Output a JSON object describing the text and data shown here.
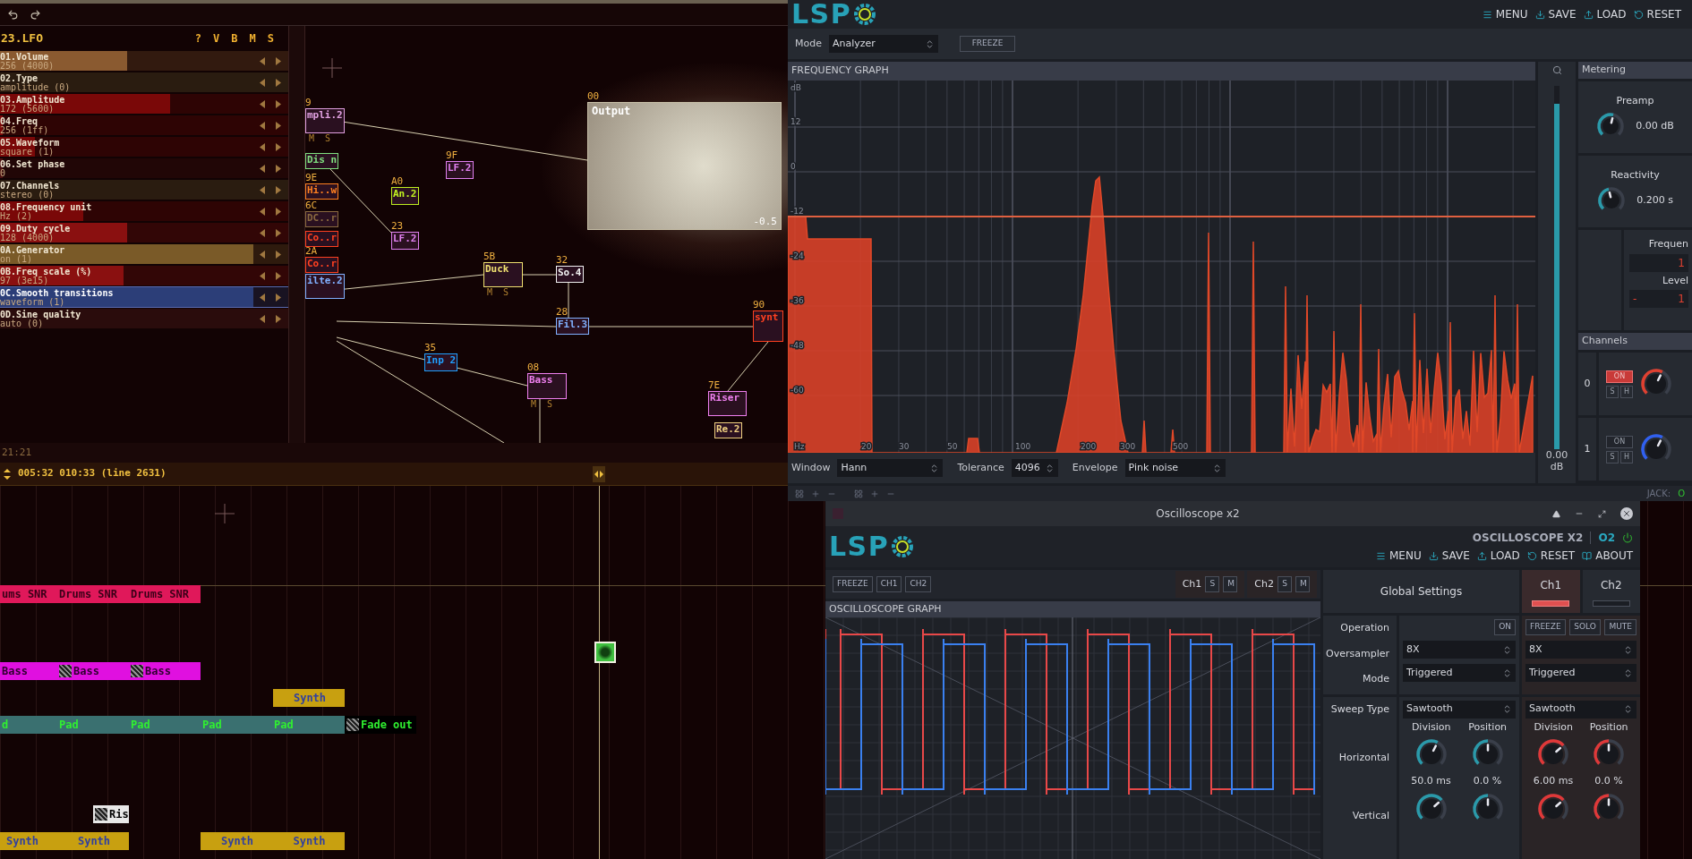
{
  "tracker": {
    "instrument": {
      "title": "23.LFO",
      "header_buttons": [
        "?",
        "V",
        "B",
        "M",
        "S"
      ]
    },
    "params": [
      {
        "name": "01.Volume",
        "value": "256 (4000)",
        "level": 0.44,
        "color": "#8a5a30",
        "selected": false
      },
      {
        "name": "02.Type",
        "value": "amplitude (0)",
        "level": 0,
        "color": "#2a1c10",
        "selected": false
      },
      {
        "name": "03.Amplitude",
        "value": "172 (5600)",
        "level": 0.59,
        "color": "#7a0808",
        "selected": false
      },
      {
        "name": "04.Freq",
        "value": "256 (1ff)",
        "level": 0.01,
        "color": "#7a0808",
        "selected": false
      },
      {
        "name": "05.Waveform",
        "value": "square (1)",
        "level": 0.12,
        "color": "#7a0808",
        "selected": false
      },
      {
        "name": "06.Set phase",
        "value": "0",
        "level": 0.01,
        "color": "#4a1010",
        "selected": false
      },
      {
        "name": "07.Channels",
        "value": "stereo (0)",
        "level": 0,
        "color": "#2a1c10",
        "selected": false
      },
      {
        "name": "08.Frequency unit",
        "value": "Hz (2)",
        "level": 0.29,
        "color": "#7a0808",
        "selected": false
      },
      {
        "name": "09.Duty cycle",
        "value": "128 (4000)",
        "level": 0.44,
        "color": "#8a1010",
        "selected": false
      },
      {
        "name": "0A.Generator",
        "value": "on (1)",
        "level": 0.88,
        "color": "#7a5a28",
        "selected": false
      },
      {
        "name": "0B.Freq scale (%)",
        "value": "97 (3e15)",
        "level": 0.43,
        "color": "#8a1010",
        "selected": false
      },
      {
        "name": "0C.Smooth transitions",
        "value": "waveform (1)",
        "level": 0.88,
        "color": "#2c3e78",
        "selected": true
      },
      {
        "name": "0D.Sine quality",
        "value": "auto (0)",
        "level": 0,
        "color": "#2a0c0c",
        "selected": false
      }
    ],
    "graph": {
      "nodes": [
        {
          "id": "9",
          "label": "mpli.2",
          "color": "#e0a0e0",
          "controls": [
            "M",
            "S"
          ]
        },
        {
          "label": "Dis n",
          "color": "#80e080"
        },
        {
          "id": "9E",
          "label": "Hi..w",
          "color": "#ff8020"
        },
        {
          "id": "6C",
          "label": "DC..r",
          "color": "#8a6a40"
        },
        {
          "label": "Co..r",
          "color": "#ff4020"
        },
        {
          "id": "2A",
          "label": "Co..r",
          "color": "#ff4020"
        },
        {
          "label": "ilte.2",
          "color": "#80b0ff"
        },
        {
          "id": "9F",
          "label": "LF.2",
          "color": "#e080f0"
        },
        {
          "id": "A0",
          "label": "An.2",
          "color": "#c0f020"
        },
        {
          "id": "23",
          "label": "LF.2",
          "color": "#e080f0"
        },
        {
          "id": "5B",
          "label": "Duck",
          "color": "#f0e070",
          "controls": [
            "M",
            "S"
          ]
        },
        {
          "id": "32",
          "label": "So.4",
          "color": "#f0f0f0"
        },
        {
          "id": "28",
          "label": "Fil.3",
          "color": "#80b0ff"
        },
        {
          "id": "35",
          "label": "Inp 2",
          "color": "#20a0ff"
        },
        {
          "id": "08",
          "label": "Bass",
          "color": "#f080f0",
          "controls": [
            "M",
            "S"
          ]
        },
        {
          "id": "7E",
          "label": "Riser",
          "color": "#f080f0"
        },
        {
          "label": "Re.2",
          "color": "#f0d080"
        },
        {
          "id": "90",
          "label": "synt",
          "color": "#ff4020"
        }
      ],
      "output": {
        "id": "00",
        "label": "Output",
        "reading": "-0.5"
      }
    },
    "timeline": {
      "clock": "21:21",
      "position": "005:32 010:33 (line 2631)",
      "tracks": [
        {
          "kind": "drums",
          "clips": [
            {
              "label": "ums SNR",
              "color": "#e0185a",
              "icon": false
            },
            {
              "label": "Drums SNR",
              "color": "#e0185a",
              "icon": false
            },
            {
              "label": "Drums SNR",
              "color": "#e0185a",
              "icon": false
            }
          ]
        },
        {
          "kind": "bass",
          "clips": [
            {
              "label": "Bass",
              "color": "#e010e0",
              "icon": false
            },
            {
              "label": "Bass",
              "color": "#e010e0",
              "icon": true
            },
            {
              "label": "Bass",
              "color": "#e010e0",
              "icon": true
            }
          ]
        },
        {
          "kind": "synth",
          "clips": [
            {
              "label": "Synth",
              "color": "#c8a010",
              "icon": false
            }
          ]
        },
        {
          "kind": "pad",
          "clips": [
            {
              "label": "d",
              "color": "#3a7070",
              "icon": false
            },
            {
              "label": "Pad",
              "color": "#3a7070",
              "icon": false
            },
            {
              "label": "Pad",
              "color": "#3a7070",
              "icon": false
            },
            {
              "label": "Pad",
              "color": "#3a7070",
              "icon": false
            },
            {
              "label": "Pad",
              "color": "#3a7070",
              "icon": false
            },
            {
              "label": "Fade out",
              "color": "#000000",
              "icon": true
            }
          ]
        },
        {
          "kind": "riser",
          "clips": [
            {
              "label": "Ris",
              "color": "#e8e8e8",
              "icon": true
            }
          ]
        },
        {
          "kind": "synth",
          "clips": [
            {
              "label": "Synth",
              "color": "#c8a010",
              "icon": false
            },
            {
              "label": "Synth",
              "color": "#c8a010",
              "icon": false
            },
            {
              "label": "Synth",
              "color": "#c8a010",
              "icon": false
            },
            {
              "label": "Synth",
              "color": "#c8a010",
              "icon": false
            }
          ]
        }
      ]
    }
  },
  "spectrum": {
    "logo": "LSP",
    "menu": [
      "MENU",
      "SAVE",
      "LOAD",
      "RESET"
    ],
    "mode": {
      "label": "Mode",
      "value": "Analyzer"
    },
    "freeze": "FREEZE",
    "graph": {
      "title": "FREQUENCY GRAPH",
      "db_labels": [
        "dB",
        "12",
        "0",
        "-12",
        "-24",
        "-36",
        "-48",
        "-60"
      ],
      "hz_labels": [
        "Hz",
        "20",
        "30",
        "50",
        "100",
        "200",
        "300",
        "500"
      ]
    },
    "controls": [
      {
        "label": "Window",
        "value": "Hann"
      },
      {
        "label": "Tolerance",
        "value": "4096"
      },
      {
        "label": "Envelope",
        "value": "Pink noise"
      }
    ],
    "meter": {
      "level": 0.95,
      "value": "0.00",
      "unit": "dB"
    },
    "metering": {
      "title": "Metering",
      "knobs": [
        {
          "label": "Preamp",
          "value": "0.00 dB",
          "level": 0.55
        },
        {
          "label": "Reactivity",
          "value": "0.200 s",
          "level": 0.45
        }
      ],
      "frequency_label": "Frequen",
      "frequency_value": "1",
      "level_label": "Level",
      "level_sign": "-",
      "level_value": "1"
    },
    "channels": {
      "title": "Channels",
      "items": [
        {
          "index": "0",
          "on": true,
          "on_label": "ON",
          "solo": "S",
          "hold": "H",
          "color": "#e04030",
          "level": 0.6
        },
        {
          "index": "1",
          "on": false,
          "on_label": "ON",
          "solo": "S",
          "hold": "H",
          "color": "#3060f0",
          "level": 0.6
        }
      ]
    },
    "status": {
      "jack_label": "JACK:",
      "jack_value": "O"
    }
  },
  "oscilloscope": {
    "window_title": "Oscilloscope x2",
    "logo": "LSP",
    "plugin_name": "OSCILLOSCOPE X2",
    "plugin_short": "O2",
    "power": true,
    "menu": [
      "MENU",
      "SAVE",
      "LOAD",
      "RESET",
      "ABOUT"
    ],
    "graph_buttons": [
      "FREEZE",
      "CH1",
      "CH2"
    ],
    "channel_groups": [
      {
        "label": "Ch1",
        "buttons": [
          "S",
          "M"
        ]
      },
      {
        "label": "Ch2",
        "buttons": [
          "S",
          "M"
        ]
      }
    ],
    "graph_title": "OSCILLOSCOPE GRAPH",
    "global_title": "Global Settings",
    "tabs": [
      {
        "label": "Ch1",
        "selected": true
      },
      {
        "label": "Ch2",
        "selected": false
      }
    ],
    "operation": {
      "label": "Operation",
      "global_button": "ON",
      "channel_buttons": [
        "FREEZE",
        "SOLO",
        "MUTE"
      ]
    },
    "selects": [
      {
        "label": "Oversampler",
        "global": "8X",
        "channel": "8X"
      },
      {
        "label": "Mode",
        "global": "Triggered",
        "channel": "Triggered"
      }
    ],
    "sweep": {
      "label": "Sweep Type",
      "global": "Sawtooth",
      "channel": "Sawtooth"
    },
    "knob_headers": [
      "Division",
      "Position",
      "Division",
      "Position"
    ],
    "knob_rows": [
      {
        "label": "Horizontal",
        "knobs": [
          {
            "value": "50.0 ms",
            "level": 0.6
          },
          {
            "value": "0.0 %",
            "level": 0.5
          },
          {
            "value": "6.00 ms",
            "level": 0.68
          },
          {
            "value": "0.0 %",
            "level": 0.5
          }
        ]
      },
      {
        "label": "Vertical",
        "knobs": [
          {
            "level": 0.68
          },
          {
            "level": 0.5
          },
          {
            "level": 0.68
          },
          {
            "level": 0.5
          }
        ]
      }
    ]
  }
}
